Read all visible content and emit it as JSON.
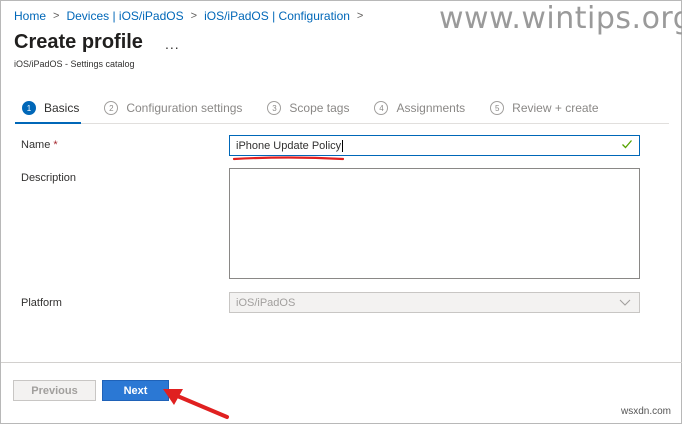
{
  "breadcrumb": {
    "items": [
      "Home",
      "Devices | iOS/iPadOS",
      "iOS/iPadOS | Configuration"
    ],
    "separator": ">"
  },
  "watermark": "www.wintips.org",
  "header": {
    "title": "Create profile",
    "more_label": "...",
    "subtitle": "iOS/iPadOS - Settings catalog"
  },
  "steps": [
    {
      "number": "1",
      "label": "Basics",
      "active": true
    },
    {
      "number": "2",
      "label": "Configuration settings",
      "active": false
    },
    {
      "number": "3",
      "label": "Scope tags",
      "active": false
    },
    {
      "number": "4",
      "label": "Assignments",
      "active": false
    },
    {
      "number": "5",
      "label": "Review + create",
      "active": false
    }
  ],
  "form": {
    "name_label": "Name",
    "required_marker": "*",
    "name_value": "iPhone Update Policy",
    "description_label": "Description",
    "description_value": "",
    "platform_label": "Platform",
    "platform_value": "iOS/iPadOS"
  },
  "footer": {
    "previous_label": "Previous",
    "next_label": "Next"
  },
  "corner_mark": "wsxdn.com",
  "colors": {
    "accent": "#0067b8",
    "next_button": "#2b78d4",
    "annotation_red": "#e02020",
    "valid_check": "#57a300"
  },
  "icons": {
    "valid": "check-icon",
    "dropdown": "chevron-down-icon",
    "more": "ellipsis-icon"
  }
}
